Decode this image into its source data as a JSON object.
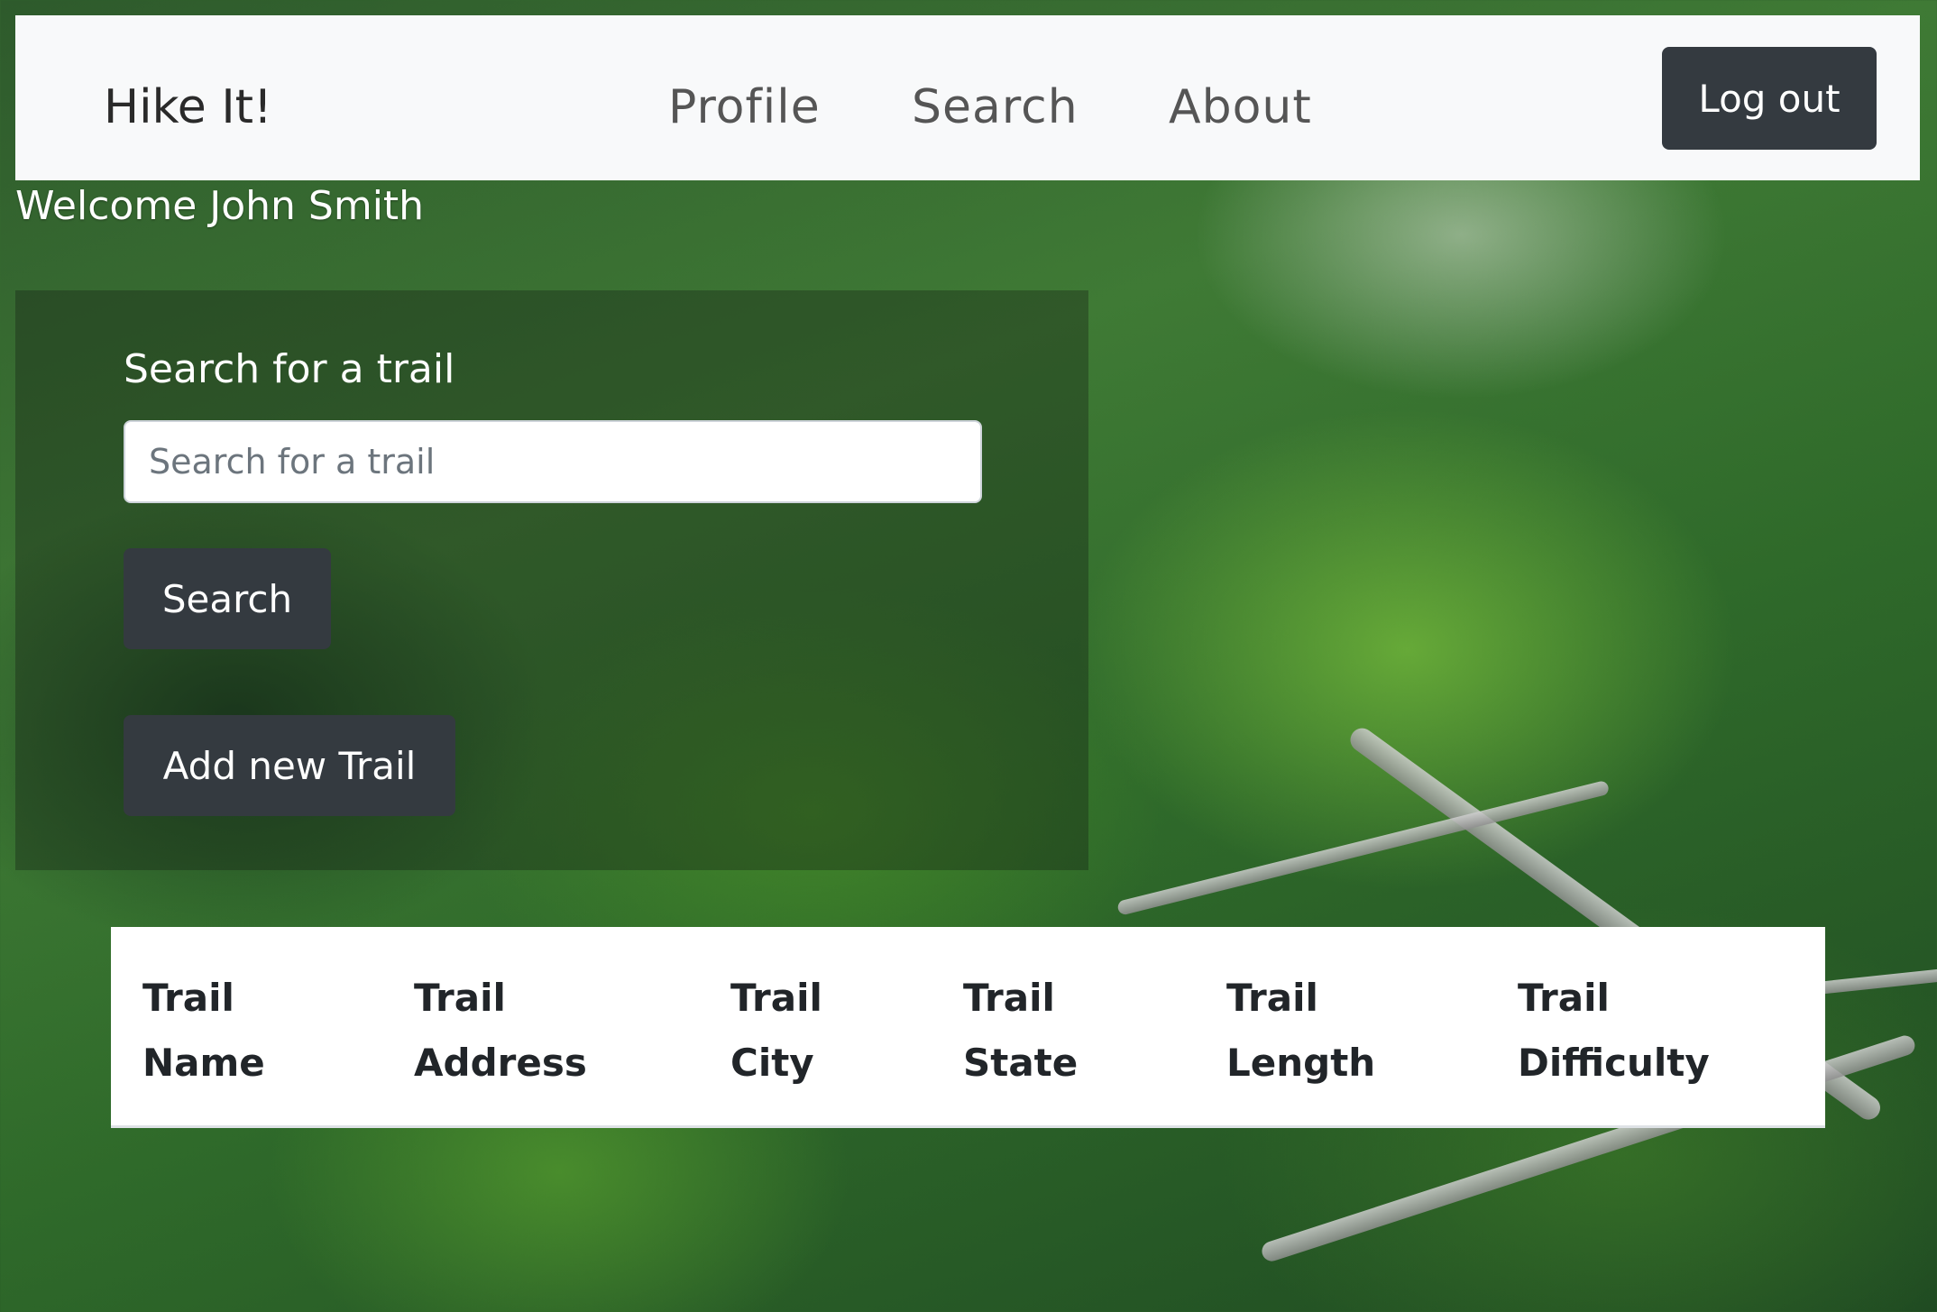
{
  "navbar": {
    "brand": "Hike It!",
    "links": [
      {
        "label": "Profile"
      },
      {
        "label": "Search"
      },
      {
        "label": "About"
      }
    ],
    "logout_label": "Log out"
  },
  "welcome": "Welcome John Smith",
  "search_panel": {
    "heading": "Search for a trail",
    "input_placeholder": "Search for a trail",
    "input_value": "",
    "search_button": "Search",
    "add_button": "Add new Trail"
  },
  "table": {
    "headers": [
      "Trail\nName",
      "Trail\nAddress",
      "Trail\nCity",
      "Trail\nState",
      "Trail\nLength",
      "Trail\nDifficulty"
    ]
  }
}
